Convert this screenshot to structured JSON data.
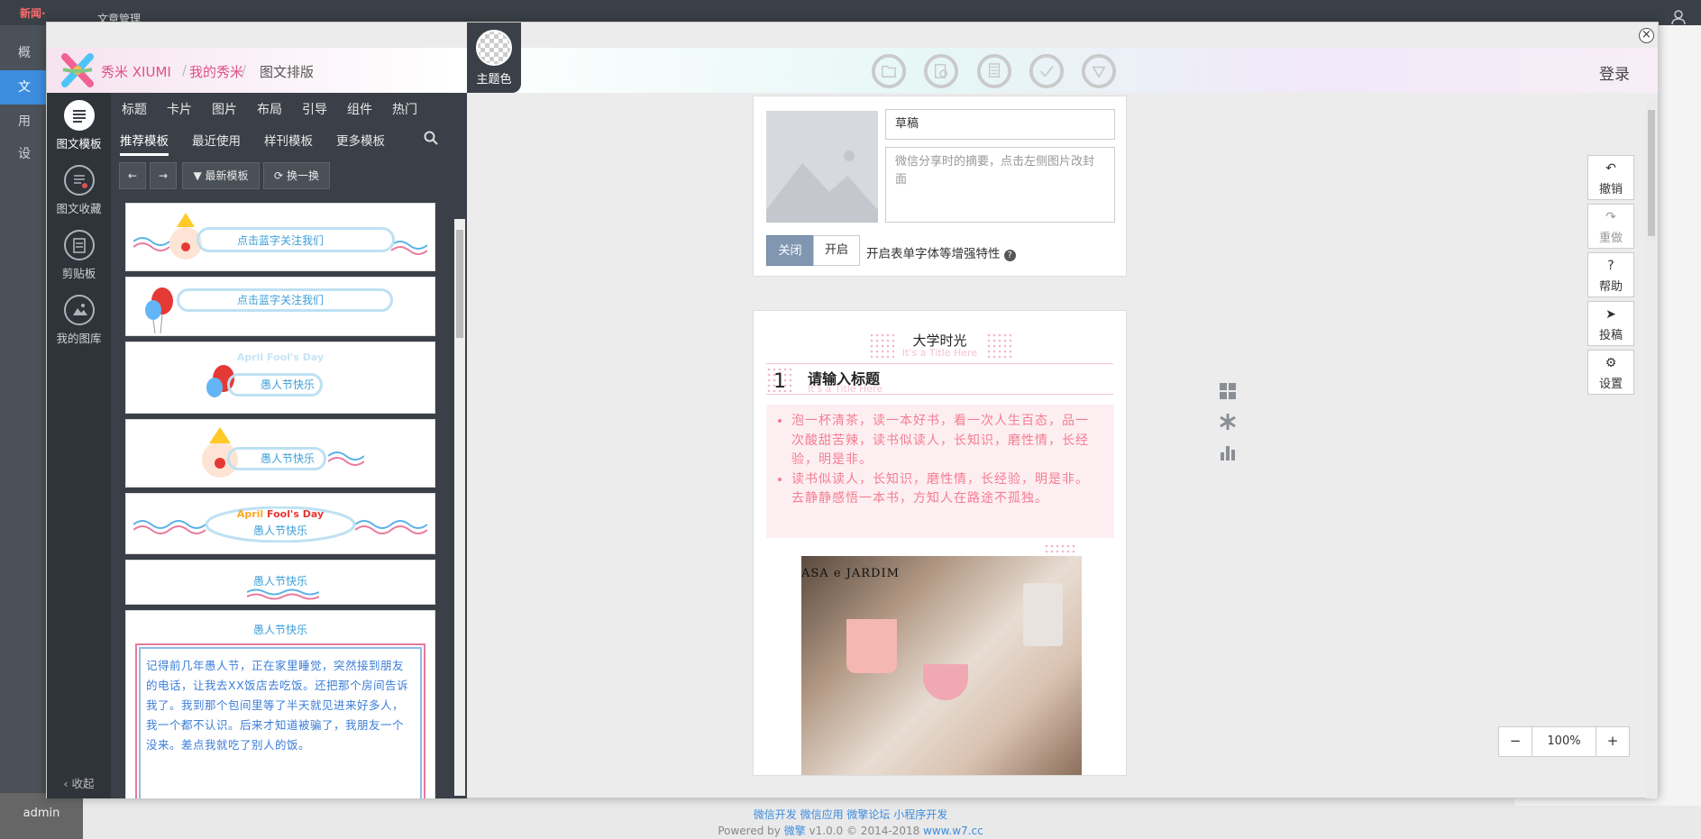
{
  "background": {
    "logo_text": "新闻·",
    "menu_title": "文章管理",
    "sidebar_items": [
      "概",
      "文",
      "用",
      "设"
    ],
    "admin_label": "admin",
    "footer_links": [
      "微信开发",
      "微信应用",
      "微擎论坛",
      "小程序开发"
    ],
    "footer_powered_prefix": "Powered by",
    "footer_powered_brand": "微擎",
    "footer_powered_version": "v1.0.0 © 2014-2018",
    "footer_powered_site": "www.w7.cc"
  },
  "modal": {
    "close_glyph": "×"
  },
  "header": {
    "breadcrumb": [
      "秀米 XIUMI",
      "我的秀米",
      "图文排版"
    ],
    "separator": "/",
    "login_label": "登录",
    "toolbar_icons": [
      "folder-icon",
      "preview-icon",
      "copy-icon",
      "check-icon",
      "dropdown-icon"
    ]
  },
  "left_panel": {
    "rail": [
      {
        "label": "图文模板",
        "icon": "template-icon"
      },
      {
        "label": "图文收藏",
        "icon": "favorite-icon"
      },
      {
        "label": "剪贴板",
        "icon": "clipboard-icon"
      },
      {
        "label": "我的图库",
        "icon": "gallery-icon"
      }
    ],
    "collapse_label": "收起",
    "collapse_glyph": "‹",
    "categories": [
      "标题",
      "卡片",
      "图片",
      "布局",
      "引导",
      "组件",
      "热门"
    ],
    "subtabs": [
      "推荐模板",
      "最近使用",
      "样刊模板",
      "更多模板"
    ],
    "theme_label": "主题色",
    "prev_glyph": "←",
    "next_glyph": "→",
    "filter_label": "最新模板",
    "refresh_label": "换一换",
    "templates": [
      {
        "label": "点击蓝字关注我们"
      },
      {
        "label": "点击蓝字关注我们"
      },
      {
        "label": "愚人节快乐",
        "sub": "April Fool's Day"
      },
      {
        "label": "愚人节快乐"
      },
      {
        "label": "愚人节快乐",
        "sub_a": "April",
        "sub_b": "Fool's Day"
      },
      {
        "label": "愚人节快乐"
      },
      {
        "label": "愚人节快乐",
        "body": "记得前几年愚人节，正在家里睡觉，突然接到朋友的电话，让我去XX饭店去吃饭。还把那个房间告诉我了。我到那个包间里等了半天就见进来好多人，我一个都不认识。后来才知道被骗了，我朋友一个没来。差点我就吃了别人的饭。"
      }
    ]
  },
  "editor": {
    "title_value": "草稿",
    "summary_placeholder": "微信分享时的摘要，点击左侧图片改封面",
    "toggle_off": "关闭",
    "toggle_on": "开启",
    "toggle_label": "开启表单字体等增强特性",
    "help_glyph": "?",
    "section_title": "大学时光",
    "section_subtitle": "It's a Title Here",
    "heading_number": "1",
    "heading_title": "请输入标题",
    "heading_subtitle": "It's a Title Here",
    "bullets": [
      "泡一杯清茶，读一本好书，看一次人生百态，品一次酸甜苦辣，读书似读人，长知识，磨性情，长经验，明是非。",
      "读书似读人，长知识，磨性情，长经验，明是非。去静静感悟一本书，方知人在路途不孤独。"
    ],
    "photo_caption": "ASA e JARDIM"
  },
  "right_tools": [
    {
      "label": "撤销",
      "glyph": "↶",
      "enabled": true
    },
    {
      "label": "重做",
      "glyph": "↷",
      "enabled": false
    },
    {
      "label": "帮助",
      "glyph": "?",
      "enabled": true
    },
    {
      "label": "投稿",
      "glyph": "➤",
      "enabled": true
    },
    {
      "label": "设置",
      "glyph": "⚙",
      "enabled": true
    }
  ],
  "zoom": {
    "value": "100%",
    "zoom_out_glyph": "−",
    "zoom_in_glyph": "+"
  },
  "colors": {
    "accent": "#e0508a",
    "panel": "#3b4048",
    "toggle_active": "#8197b1",
    "bullet_text": "#f57c92"
  }
}
